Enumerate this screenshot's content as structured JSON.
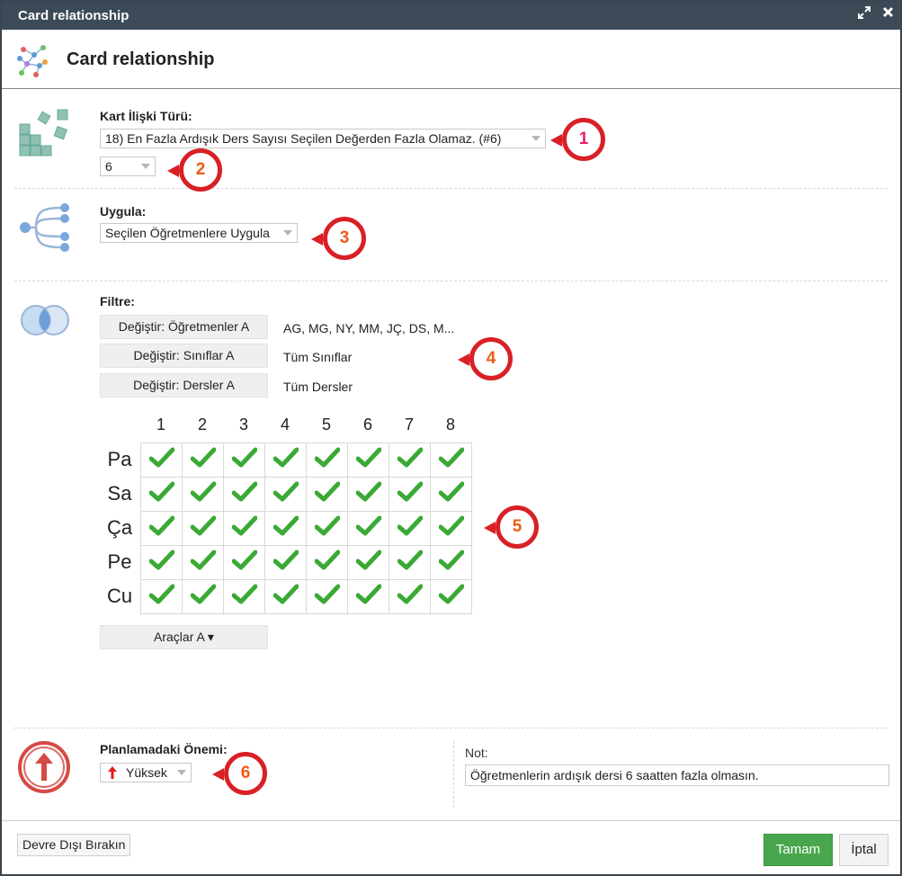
{
  "window": {
    "title": "Card relationship",
    "header_title": "Card relationship"
  },
  "relation": {
    "label": "Kart İlişki Türü:",
    "type_value": "18) En Fazla Ardışık Ders Sayısı Seçilen Değerden Fazla Olamaz. (#6)",
    "count_value": "6"
  },
  "apply": {
    "label": "Uygula:",
    "value": "Seçilen Öğretmenlere Uygula"
  },
  "filter": {
    "label": "Filtre:",
    "rows": [
      {
        "button": "Değiştir: Öğretmenler A",
        "value": "AG, MG, NY, MM, JÇ, DS, M..."
      },
      {
        "button": "Değiştir: Sınıflar A",
        "value": "Tüm Sınıflar"
      },
      {
        "button": "Değiştir: Dersler A",
        "value": "Tüm Dersler"
      }
    ]
  },
  "grid": {
    "columns": [
      "1",
      "2",
      "3",
      "4",
      "5",
      "6",
      "7",
      "8"
    ],
    "rows": [
      "Pa",
      "Sa",
      "Ça",
      "Pe",
      "Cu"
    ],
    "checked": [
      [
        true,
        true,
        true,
        true,
        true,
        true,
        true,
        true
      ],
      [
        true,
        true,
        true,
        true,
        true,
        true,
        true,
        true
      ],
      [
        true,
        true,
        true,
        true,
        true,
        true,
        true,
        true
      ],
      [
        true,
        true,
        true,
        true,
        true,
        true,
        true,
        true
      ],
      [
        true,
        true,
        true,
        true,
        true,
        true,
        true,
        true
      ]
    ]
  },
  "tools_button": "Araçlar A ▾",
  "importance": {
    "label": "Planlamadaki Önemi:",
    "value": "Yüksek"
  },
  "note": {
    "label": "Not:",
    "value": "Öğretmenlerin ardışık dersi 6 saatten fazla olmasın."
  },
  "callouts": [
    "1",
    "2",
    "3",
    "4",
    "5",
    "6"
  ],
  "footer": {
    "disable_label": "Devre Dışı Bırakın",
    "ok_label": "Tamam",
    "cancel_label": "İptal"
  },
  "colors": {
    "titlebar": "#3b4a56",
    "callout_border": "#d92026",
    "callout_text_pink": "#e0246e",
    "callout_text_orange": "#ef5a13",
    "check_green": "#3aa935",
    "ok_button": "#48a64c"
  }
}
